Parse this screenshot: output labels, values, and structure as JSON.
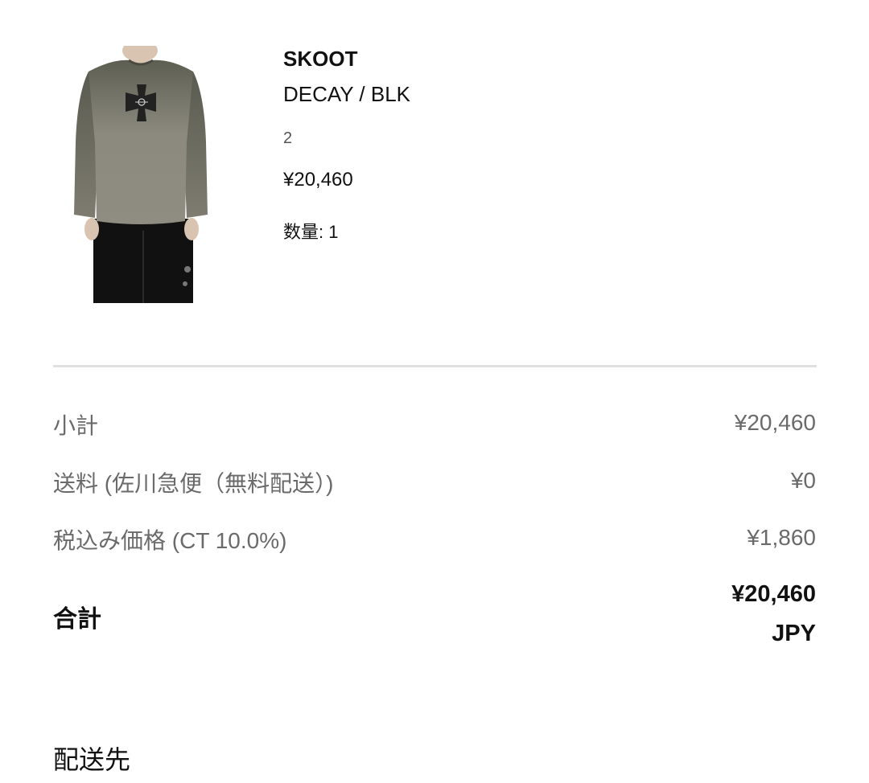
{
  "product": {
    "image_icon": "sweater-photo",
    "brand": "SKOOT",
    "variant": "DECAY / BLK",
    "size": "2",
    "price": "¥20,460",
    "quantity": "数量: 1"
  },
  "summary": {
    "subtotal_label": "小計",
    "subtotal_value": "¥20,460",
    "shipping_label": "送料 (佐川急便（無料配送）)",
    "shipping_value": "¥0",
    "tax_label": "税込み価格 (CT 10.0%)",
    "tax_value": "¥1,860",
    "total_label": "合計",
    "total_amount": "¥20,460",
    "total_currency": "JPY"
  },
  "shipping": {
    "heading": "配送先"
  },
  "colors": {
    "text_primary": "#111111",
    "text_secondary": "#6a6a6a",
    "divider": "#e0e0e0",
    "background": "#ffffff"
  }
}
